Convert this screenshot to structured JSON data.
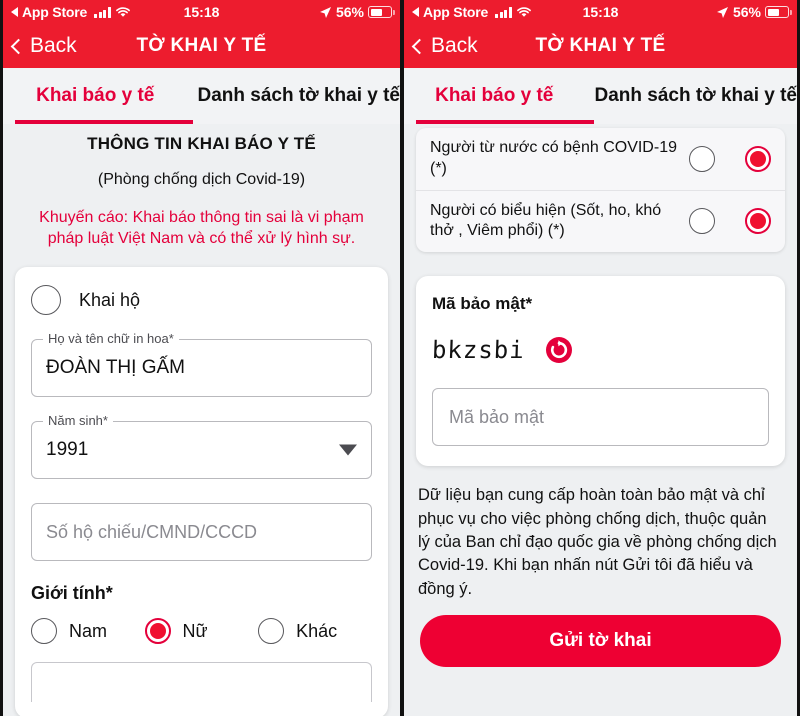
{
  "statusbar": {
    "back_app": "App Store",
    "back_triangle_icon": "triangle-left-icon",
    "signal_icon": "cellular-bars-icon",
    "wifi_icon": "wifi-icon",
    "time": "15:18",
    "location_icon": "location-arrow-icon",
    "battery_pct": "56%",
    "battery_icon": "battery-icon"
  },
  "navbar": {
    "back_label": "Back",
    "back_chevron_icon": "chevron-left-icon",
    "title": "TỜ KHAI Y TẾ"
  },
  "tabs": {
    "active": "Khai báo y tế",
    "inactive": "Danh sách tờ khai y tế"
  },
  "colors": {
    "header_red": "#ED1C2E",
    "accent_red": "#E4003B",
    "button_red": "#EE0033",
    "page_bg": "#EEF0F2"
  },
  "left": {
    "intro": {
      "title": "THÔNG TIN KHAI BÁO Y TẾ",
      "subtitle": "(Phòng chống dịch Covid-19)",
      "warning": "Khuyến cáo: Khai báo thông tin sai là vi phạm pháp luật Việt Nam và có thể xử lý hình sự."
    },
    "proxy_declare": {
      "label": "Khai hộ",
      "checked": false
    },
    "fields": [
      {
        "legend": "Họ và tên chữ in hoa*",
        "value": "ĐOÀN THỊ GẤM",
        "placeholder": ""
      },
      {
        "legend": "Năm sinh*",
        "value": "1991",
        "placeholder": "",
        "dropdown": true
      },
      {
        "legend": "",
        "value": "",
        "placeholder": "Số hộ chiếu/CMND/CCCD"
      }
    ],
    "gender": {
      "label": "Giới tính*",
      "options": [
        {
          "label": "Nam",
          "checked": false
        },
        {
          "label": "Nữ",
          "checked": true
        },
        {
          "label": "Khác",
          "checked": false
        }
      ]
    }
  },
  "right": {
    "questions": [
      {
        "text": "Người từ nước có bệnh COVID-19 (*)",
        "no_checked": false,
        "yes_checked": true
      },
      {
        "text": "Người có biểu hiện (Sốt, ho, khó thở , Viêm phổi) (*)",
        "no_checked": false,
        "yes_checked": true
      }
    ],
    "security": {
      "label": "Mã bảo mật*",
      "captcha_text": "bkzsbi",
      "refresh_icon": "refresh-captcha-icon",
      "input_placeholder": "Mã bảo mật",
      "input_value": ""
    },
    "notice": "Dữ liệu bạn cung cấp hoàn toàn bảo mật và chỉ phục vụ cho việc phòng chống dịch, thuộc quản lý của Ban chỉ đạo quốc gia về phòng chống dịch Covid-19. Khi bạn nhấn nút Gửi tôi đã hiểu và đồng ý.",
    "submit_label": "Gửi tờ khai",
    "cursor_icon": "hand-pointer-icon"
  }
}
